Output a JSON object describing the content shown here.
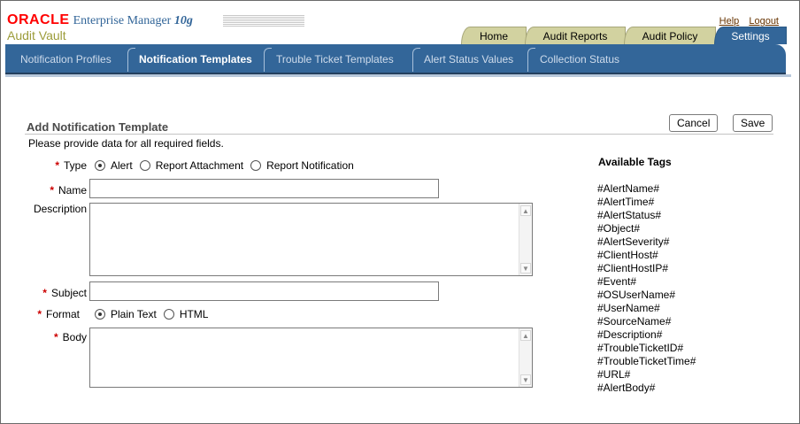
{
  "brand": {
    "logo": "ORACLE",
    "product": "Enterprise Manager ",
    "version": "10g",
    "subtitle": "Audit Vault"
  },
  "global_links": {
    "help": "Help",
    "logout": "Logout"
  },
  "tabs": [
    {
      "label": "Home",
      "active": false
    },
    {
      "label": "Audit Reports",
      "active": false
    },
    {
      "label": "Audit Policy",
      "active": false
    },
    {
      "label": "Settings",
      "active": true
    }
  ],
  "subtabs": [
    {
      "label": "Notification Profiles",
      "active": false
    },
    {
      "label": "Notification Templates",
      "active": true
    },
    {
      "label": "Trouble Ticket Templates",
      "active": false
    },
    {
      "label": "Alert Status Values",
      "active": false
    },
    {
      "label": "Collection Status",
      "active": false
    }
  ],
  "page": {
    "title": "Add Notification Template",
    "hint": "Please provide data for all required fields.",
    "cancel_label": "Cancel",
    "save_label": "Save"
  },
  "form": {
    "required_marker": "*",
    "type": {
      "label": "Type",
      "options": [
        "Alert",
        "Report Attachment",
        "Report Notification"
      ],
      "selected": "Alert"
    },
    "name": {
      "label": "Name",
      "value": ""
    },
    "description": {
      "label": "Description",
      "value": ""
    },
    "subject": {
      "label": "Subject",
      "value": ""
    },
    "format": {
      "label": "Format",
      "options": [
        "Plain Text",
        "HTML"
      ],
      "selected": "Plain Text"
    },
    "body": {
      "label": "Body",
      "value": ""
    }
  },
  "available_tags": {
    "title": "Available Tags",
    "items": [
      "#AlertName#",
      "#AlertTime#",
      "#AlertStatus#",
      "#Object#",
      "#AlertSeverity#",
      "#ClientHost#",
      "#ClientHostIP#",
      "#Event#",
      "#OSUserName#",
      "#UserName#",
      "#SourceName#",
      "#Description#",
      "#TroubleTicketID#",
      "#TroubleTicketTime#",
      "#URL#",
      "#AlertBody#"
    ]
  },
  "scroll_up_glyph": "▲",
  "scroll_down_glyph": "▼"
}
